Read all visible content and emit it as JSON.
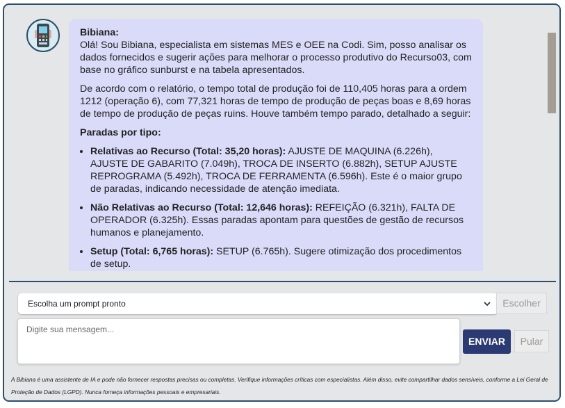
{
  "chat": {
    "avatar_icon": "robot-avatar-icon",
    "message": {
      "sender": "Bibiana:",
      "intro": "Olá! Sou Bibiana, especialista em sistemas MES e OEE na Codi. Sim, posso analisar os dados fornecidos e sugerir ações para melhorar o processo produtivo do Recurso03, com base no gráfico sunburst e na tabela apresentados.",
      "report": "De acordo com o relatório, o tempo total de produção foi de 110,405 horas para a ordem 1212 (operação 6), com 77,321 horas de tempo de produção de peças boas e 8,69 horas de tempo de produção de peças ruins. Houve também tempo parado, detalhado a seguir:",
      "section_title": "Paradas por tipo:",
      "items": [
        {
          "title": "Relativas ao Recurso (Total: 35,20 horas):",
          "text": " AJUSTE DE MAQUINA (6.226h), AJUSTE DE GABARITO (7.049h), TROCA DE INSERTO (6.882h), SETUP AJUSTE REPROGRAMA (5.492h), TROCA DE FERRAMENTA (6.596h). Este é o maior grupo de paradas, indicando necessidade de atenção imediata."
        },
        {
          "title": "Não Relativas ao Recurso (Total: 12,646 horas):",
          "text": " REFEIÇÃO (6.321h), FALTA DE OPERADOR (6.325h). Essas paradas apontam para questões de gestão de recursos humanos e planejamento."
        },
        {
          "title": "Setup (Total: 6,765 horas):",
          "text": " SETUP (6.765h). Sugere otimização dos procedimentos de setup."
        }
      ]
    }
  },
  "input": {
    "prompt_select_value": "Escolha um prompt pronto",
    "choose_label": "Escolher",
    "message_placeholder": "Digite sua mensagem...",
    "send_label": "ENVIAR",
    "skip_label": "Pular"
  },
  "disclaimer": "A Bibiana é uma assistente de IA e pode não fornecer respostas precisas ou completas. Verifique informações críticas com especialistas. Além disso, evite compartilhar dados sensíveis, conforme a Lei Geral de Proteção de Dados (LGPD). Nunca forneça informações pessoais e empresariais.",
  "colors": {
    "panel_border": "#2b4e6e",
    "bubble_background": "#dadbf9",
    "send_button": "#2c3a73"
  }
}
